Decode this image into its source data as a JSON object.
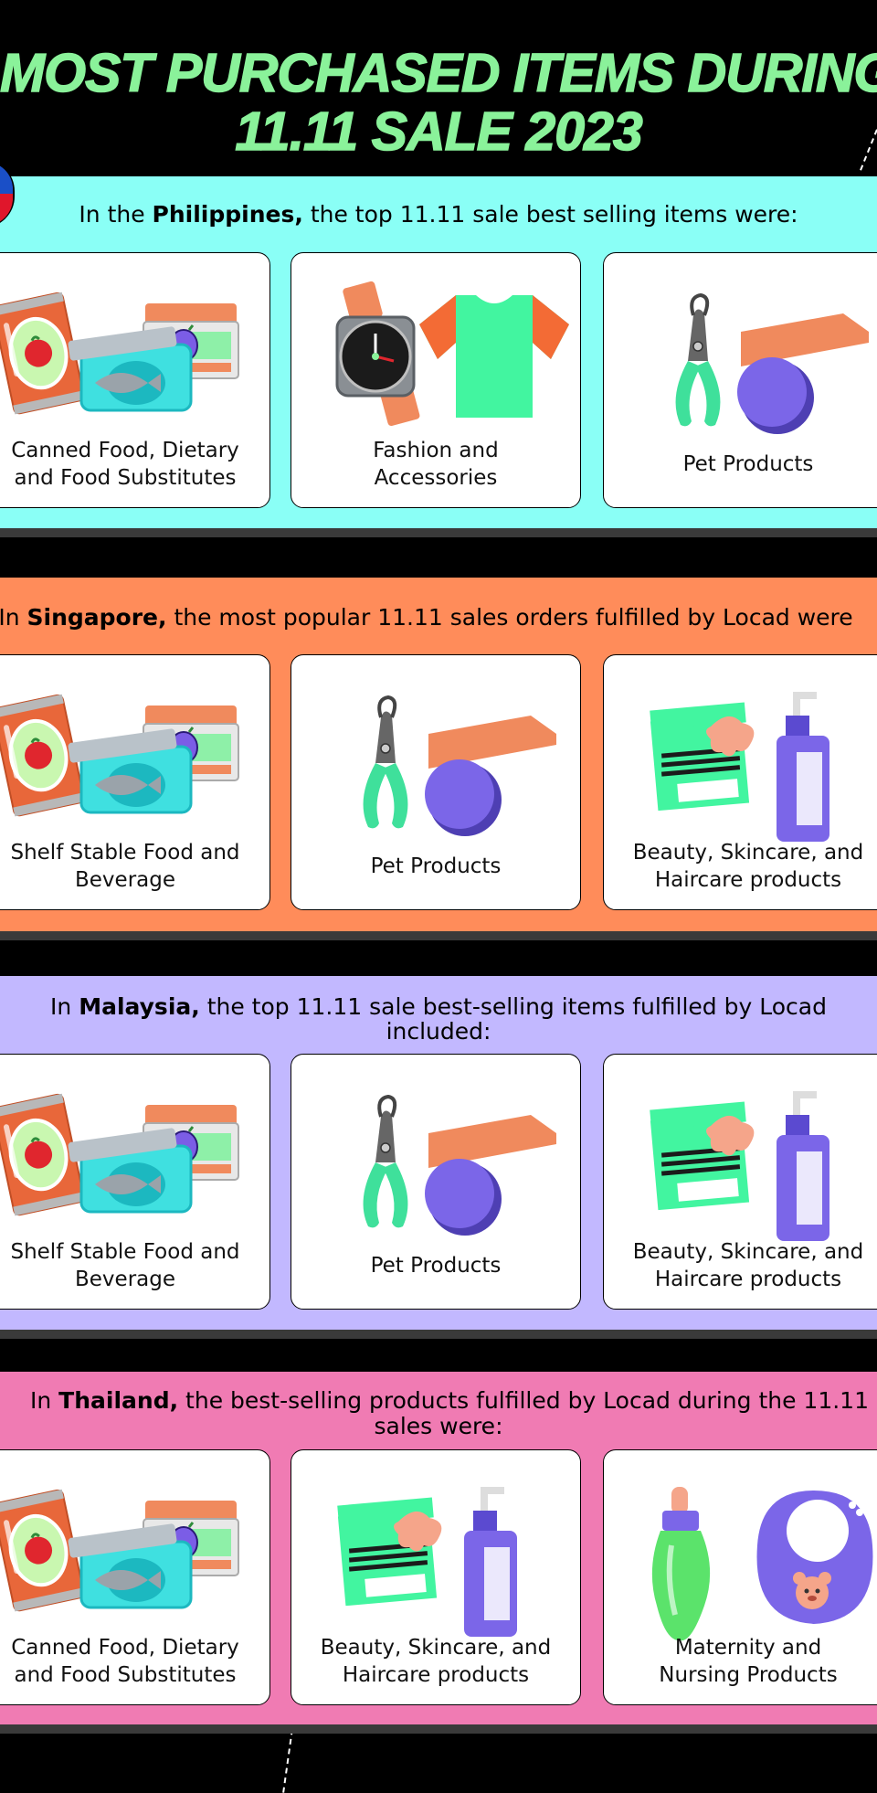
{
  "title": {
    "line1": "MOST PURCHASED ITEMS DURING",
    "line2": "11.11 SALE 2023"
  },
  "colors": {
    "philippines": "#8afff6",
    "singapore": "#ff8c5a",
    "malaysia": "#c2b8ff",
    "thailand": "#f07bb3",
    "title": "#8af29a"
  },
  "sections": [
    {
      "pre": "In the ",
      "country": "Philippines,",
      "post": " the top 11.11 sale best selling items were:",
      "line2": "",
      "cards": [
        {
          "label": "Canned Food, Dietary\nand Food Substitutes",
          "icon": "canned-food-icon"
        },
        {
          "label": "Fashion and\nAccessories",
          "icon": "fashion-icon"
        },
        {
          "label": "Pet Products",
          "icon": "pet-products-icon"
        }
      ]
    },
    {
      "pre": "In ",
      "country": "Singapore,",
      "post": " the most popular 11.11 sales orders fulfilled by Locad were",
      "line2": "",
      "cards": [
        {
          "label": "Shelf Stable Food and\nBeverage",
          "icon": "canned-food-icon"
        },
        {
          "label": "Pet Products",
          "icon": "pet-products-icon"
        },
        {
          "label": "Beauty, Skincare, and\nHaircare products",
          "icon": "beauty-icon"
        }
      ]
    },
    {
      "pre": "In ",
      "country": "Malaysia,",
      "post": " the top 11.11 sale best-selling items fulfilled by Locad",
      "line2": "included:",
      "cards": [
        {
          "label": "Shelf Stable Food and\nBeverage",
          "icon": "canned-food-icon"
        },
        {
          "label": "Pet Products",
          "icon": "pet-products-icon"
        },
        {
          "label": "Beauty, Skincare, and\nHaircare products",
          "icon": "beauty-icon"
        }
      ]
    },
    {
      "pre": "In ",
      "country": "Thailand,",
      "post": " the best-selling products fulfilled by Locad during the 11.11",
      "line2": "sales were:",
      "cards": [
        {
          "label": "Canned Food, Dietary\nand Food Substitutes",
          "icon": "canned-food-icon"
        },
        {
          "label": "Beauty, Skincare, and\nHaircare products",
          "icon": "beauty-icon"
        },
        {
          "label": "Maternity and\nNursing Products",
          "icon": "maternity-icon"
        }
      ]
    }
  ]
}
